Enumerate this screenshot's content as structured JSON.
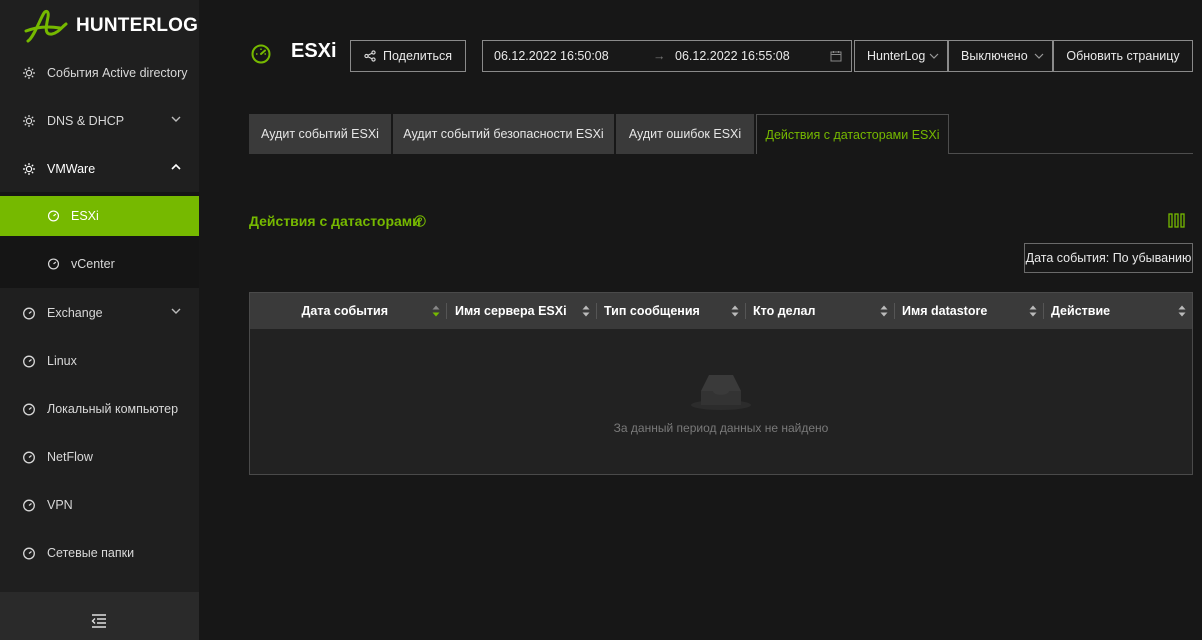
{
  "app": {
    "brand": "HUNTERLOG",
    "accent_color": "#76b900"
  },
  "sidebar": {
    "items": [
      {
        "label": "События Active directory",
        "icon": "gear-icon"
      },
      {
        "label": "DNS & DHCP",
        "icon": "gear-icon",
        "expandable": true
      },
      {
        "label": "VMWare",
        "icon": "gear-icon",
        "expanded": true
      },
      {
        "label": "ESXi",
        "icon": "dashboard-icon",
        "active": true
      },
      {
        "label": "vCenter",
        "icon": "dashboard-icon"
      },
      {
        "label": "Exchange",
        "icon": "dashboard-icon",
        "expandable": true
      },
      {
        "label": "Linux",
        "icon": "dashboard-icon"
      },
      {
        "label": "Локальный компьютер",
        "icon": "dashboard-icon"
      },
      {
        "label": "NetFlow",
        "icon": "dashboard-icon"
      },
      {
        "label": "VPN",
        "icon": "dashboard-icon"
      },
      {
        "label": "Сетевые папки",
        "icon": "dashboard-icon"
      }
    ],
    "collapse_icon": "menu-collapse-icon"
  },
  "header": {
    "title": "ESXi",
    "share_label": "Поделиться",
    "date_from": "06.12.2022 16:50:08",
    "date_arrow": "→",
    "date_to": "06.12.2022 16:55:08",
    "source": "HunterLog",
    "auto_refresh": "Выключено",
    "refresh_label": "Обновить страницу"
  },
  "tabs": [
    {
      "label": "Аудит событий ESXi"
    },
    {
      "label": "Аудит событий безопасности ESXi"
    },
    {
      "label": "Аудит ошибок ESXi"
    },
    {
      "label": "Действия с датасторами ESXi",
      "active": true
    }
  ],
  "section": {
    "title": "Действия с датасторами",
    "sort_label": "Дата события: По убыванию"
  },
  "table": {
    "columns": [
      "Дата события",
      "Имя сервера ESXi",
      "Тип сообщения",
      "Кто делал",
      "Имя datastore",
      "Действие"
    ],
    "rows": [],
    "empty_text": "За данный период данных не найдено"
  }
}
